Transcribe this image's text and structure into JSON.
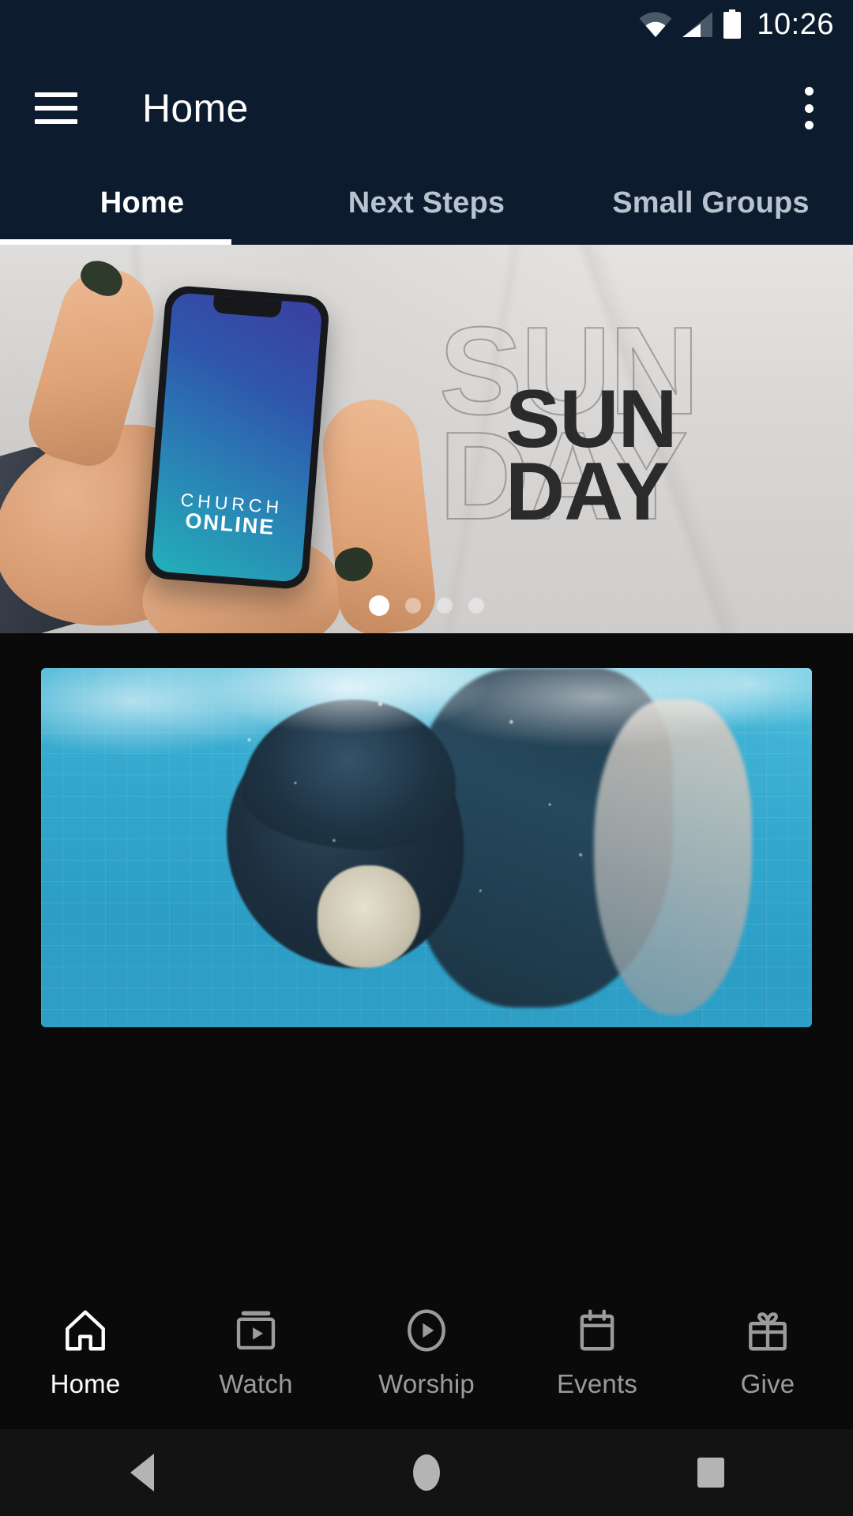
{
  "status_bar": {
    "time": "10:26",
    "icons": [
      "wifi-icon",
      "cellular-signal-icon",
      "battery-icon"
    ]
  },
  "app_bar": {
    "menu_icon": "hamburger-menu-icon",
    "title": "Home",
    "overflow_icon": "overflow-menu-icon"
  },
  "tabs": {
    "items": [
      {
        "label": "Home",
        "active": true
      },
      {
        "label": "Next Steps",
        "active": false
      },
      {
        "label": "Small Groups",
        "active": false
      }
    ]
  },
  "hero": {
    "phone_screen_line1": "CHURCH",
    "phone_screen_line2": "ONLINE",
    "poster_ghost_text": "SUN\nDAY",
    "poster_solid_text": "SUN\nDAY",
    "carousel": {
      "total": 4,
      "active_index": 0
    }
  },
  "feed": {
    "card_alt": "underwater-swimmer-photo"
  },
  "bottom_nav": {
    "items": [
      {
        "label": "Home",
        "icon": "home-icon",
        "active": true
      },
      {
        "label": "Watch",
        "icon": "video-box-icon",
        "active": false
      },
      {
        "label": "Worship",
        "icon": "play-circle-icon",
        "active": false
      },
      {
        "label": "Events",
        "icon": "calendar-icon",
        "active": false
      },
      {
        "label": "Give",
        "icon": "gift-icon",
        "active": false
      }
    ]
  },
  "system_nav": {
    "back": "back-triangle-icon",
    "home": "home-circle-icon",
    "recents": "recents-square-icon"
  },
  "colors": {
    "app_bar_bg": "#0d1b2e",
    "content_bg": "#0a0a0a",
    "accent_white": "#ffffff",
    "inactive_text": "#9b9b9b",
    "tab_inactive": "#b9c2cf"
  }
}
